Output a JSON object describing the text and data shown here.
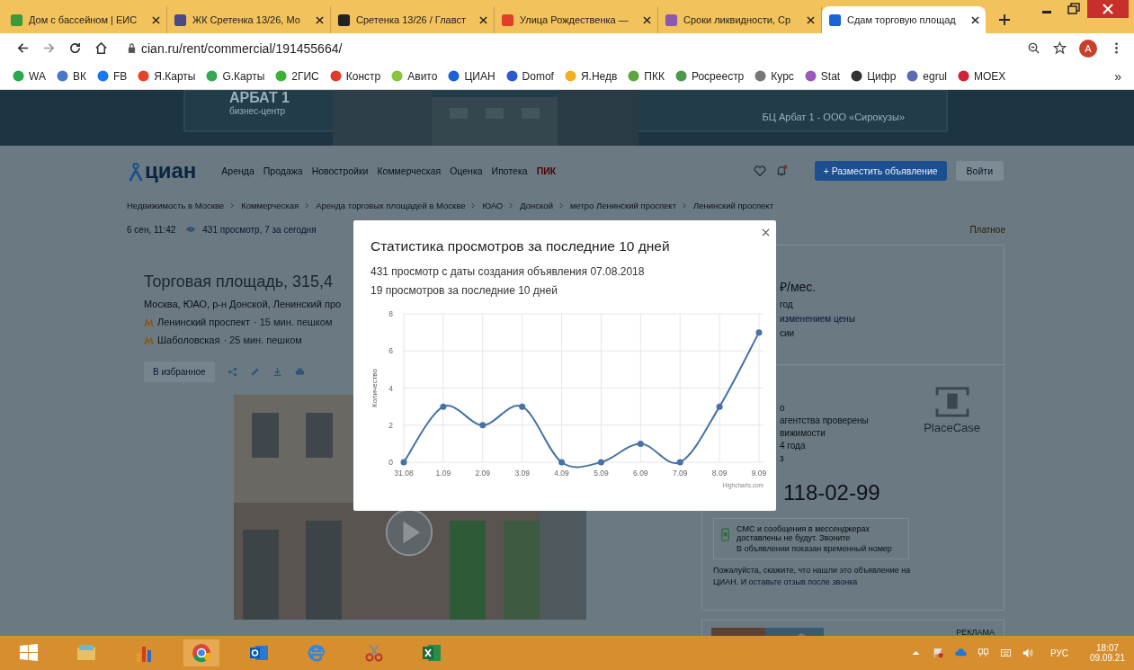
{
  "browser": {
    "tabs": [
      {
        "title": "Дом с бассейном | ЕИС",
        "selected": false,
        "color": "#3a9a3a"
      },
      {
        "title": "ЖК Сретенка 13/26, Мо",
        "selected": false,
        "color": "#4a4a8a"
      },
      {
        "title": "Сретенка 13/26 / Главст",
        "selected": false,
        "color": "#222222"
      },
      {
        "title": "Улица Рождественка —",
        "selected": false,
        "color": "#e0402a"
      },
      {
        "title": "Сроки ликвидности, Ср",
        "selected": false,
        "color": "#8a5ab0"
      },
      {
        "title": "Сдам торговую площад",
        "selected": true,
        "color": "#1a62d6"
      }
    ],
    "address": "cian.ru/rent/commercial/191455664/",
    "profile_initial": "A",
    "bookmarks": [
      {
        "label": "WA",
        "color": "#2aa84a"
      },
      {
        "label": "ВК",
        "color": "#4a76c8"
      },
      {
        "label": "FB",
        "color": "#1877f2"
      },
      {
        "label": "Я.Карты",
        "color": "#e8402a"
      },
      {
        "label": "G.Карты",
        "color": "#34a853"
      },
      {
        "label": "2ГИС",
        "color": "#3ab23a"
      },
      {
        "label": "Констр",
        "color": "#e03a2a"
      },
      {
        "label": "Авито",
        "color": "#8ac43a"
      },
      {
        "label": "ЦИАН",
        "color": "#1a62d6"
      },
      {
        "label": "Domof",
        "color": "#2a5ad0"
      },
      {
        "label": "Я.Недв",
        "color": "#f0b020"
      },
      {
        "label": "ПКК",
        "color": "#5aa83a"
      },
      {
        "label": "Росреестр",
        "color": "#4a9a4a"
      },
      {
        "label": "Курс",
        "color": "#777777"
      },
      {
        "label": "Stat",
        "color": "#9a5ab8"
      },
      {
        "label": "Цифр",
        "color": "#333333"
      },
      {
        "label": "egrul",
        "color": "#5a6ab0"
      },
      {
        "label": "MOEX",
        "color": "#d0203a"
      }
    ],
    "more": "»"
  },
  "banner": {
    "name": "АРБАТ 1",
    "subtitle": "бизнес-центр",
    "caption": "БЦ Арбат 1 - ООО «Сирокузы»"
  },
  "header": {
    "logo": "циан",
    "nav": [
      "Аренда",
      "Продажа",
      "Новостройки",
      "Коммерческая",
      "Оценка",
      "Ипотека"
    ],
    "promo": "ПИК",
    "post_button": "+ Разместить объявление",
    "login": "Войти"
  },
  "breadcrumbs": [
    "Недвижимость в Москве",
    "Коммерческая",
    "Аренда торговых площадей в Москве",
    "ЮАО",
    "Донской",
    "метро Ленинский проспект",
    "Ленинский проспект"
  ],
  "meta": {
    "date": "6 сен, 11:42",
    "views": "431 просмотр, 7 за сегодня",
    "paid": "Платное"
  },
  "listing": {
    "title": "Торговая площадь, 315,4",
    "address": "Москва, ЮАО, р-н Донской, Ленинский про",
    "metro": [
      {
        "station": "Ленинский проспект",
        "walk": "· 15 мин. пешком"
      },
      {
        "station": "Шаболовская",
        "walk": "· 25 мин. пешком"
      }
    ],
    "favorite": "В избранное"
  },
  "offer": {
    "price": "₽/мес.",
    "lines": [
      "год",
      "изменением цены",
      "сии"
    ],
    "agent_lines": [
      "о",
      "агентства проверены",
      "вижимости",
      "4 года",
      "з"
    ],
    "phone": "118-02-99",
    "agency": "PlaceCase",
    "sms_title": "СМС и сообщения в мессенджерах доставлены не будут. Звоните",
    "sms_note": "В объявлении показан временный номер",
    "feedback": "Пожалуйста, скажите, что нашли это объявление на ЦИАН. И **оставьте отзыв после звонка**",
    "ad_label": "РЕКЛАМА"
  },
  "modal": {
    "title": "Статистика просмотров за последние 10 дней",
    "total": "431 просмотр с даты создания объявления 07.08.2018",
    "recent": "19 просмотров за последние 10 дней",
    "credit": "Highcharts.com",
    "chart_data": {
      "type": "line",
      "ylabel": "Количество",
      "categories": [
        "31.08",
        "1.09",
        "2.09",
        "3.09",
        "4.09",
        "5.09",
        "6.09",
        "7.09",
        "8.09",
        "9.09"
      ],
      "series": [
        {
          "color": "#4572a7",
          "marker": true,
          "values": [
            0,
            3,
            2,
            3,
            0,
            0,
            1,
            0,
            3,
            7
          ]
        }
      ],
      "ylim": [
        0,
        8
      ],
      "yticks": [
        0,
        2,
        4,
        6,
        8
      ],
      "grid": true
    }
  },
  "taskbar": {
    "language": "РУС",
    "time": "18:07",
    "date": "09.09.21"
  }
}
